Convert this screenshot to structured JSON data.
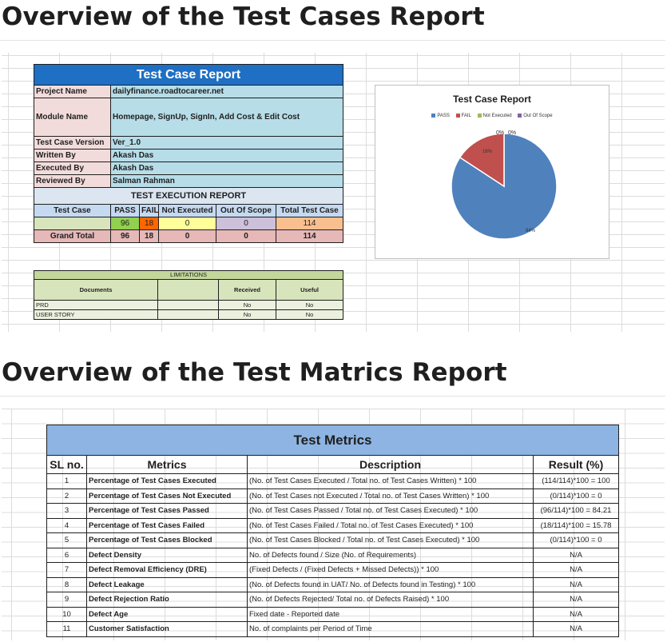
{
  "headings": {
    "section1": "Overview of the Test Cases Report",
    "section2": "Overview of the Test Matrics Report"
  },
  "test_case_report": {
    "title": "Test Case Report",
    "fields": [
      {
        "label": "Project Name",
        "value": "dailyfinance.roadtocareer.net"
      },
      {
        "label": "Module Name",
        "value": "Homepage, SignUp, SignIn, Add Cost & Edit Cost"
      },
      {
        "label": "Test Case Version",
        "value": "Ver_1.0"
      },
      {
        "label": "Written By",
        "value": "Akash Das"
      },
      {
        "label": "Executed By",
        "value": "Akash Das"
      },
      {
        "label": "Reviewed By",
        "value": "Salman Rahman"
      }
    ],
    "execution_report_title": "TEST EXECUTION REPORT",
    "columns": [
      "Test Case",
      "PASS",
      "FAIL",
      "Not Executed",
      "Out Of Scope",
      "Total Test Case"
    ],
    "row": {
      "pass": "96",
      "fail": "18",
      "not_executed": "0",
      "out_of_scope": "0",
      "total": "114"
    },
    "grand_total": {
      "label": "Grand Total",
      "pass": "96",
      "fail": "18",
      "not_executed": "0",
      "out_of_scope": "0",
      "total": "114"
    },
    "colors": {
      "pass": "#92d050",
      "fail": "#ff6600",
      "not_executed": "#ffff99",
      "out_of_scope": "#ccc0da",
      "total": "#fabf8f"
    }
  },
  "limitations": {
    "title": "LIMITATIONS",
    "columns": [
      "Documents",
      "",
      "Received",
      "Useful"
    ],
    "rows": [
      {
        "document": "PRD",
        "received": "No",
        "useful": "No"
      },
      {
        "document": "USER STORY",
        "received": "No",
        "useful": "No"
      }
    ]
  },
  "chart_data": {
    "type": "pie",
    "title": "Test Case Report",
    "categories": [
      "PASS",
      "FAIL",
      "Not Executed",
      "Out Of Scope"
    ],
    "values": [
      96,
      18,
      0,
      0
    ],
    "labels": [
      "84%",
      "16%",
      "0%",
      "0%"
    ],
    "colors": [
      "#4f81bd",
      "#c0504d",
      "#9bbb59",
      "#8064a2"
    ],
    "legend_position": "top"
  },
  "metrics": {
    "title": "Test Metrics",
    "columns": [
      "SL no.",
      "Metrics",
      "Description",
      "Result (%)"
    ],
    "rows": [
      {
        "sl": "1",
        "metric": "Percentage of Test Cases Executed",
        "description": "(No. of Test Cases Executed / Total no. of Test Cases Written) * 100",
        "result": "(114/114)*100 = 100"
      },
      {
        "sl": "2",
        "metric": "Percentage of Test Cases Not Executed",
        "description": "(No. of Test Cases not Executed / Total no. of Test Cases Written) * 100",
        "result": "(0/114)*100 = 0"
      },
      {
        "sl": "3",
        "metric": "Percentage of Test Cases Passed",
        "description": "(No. of Test Cases Passed / Total no. of Test Cases Executed) * 100",
        "result": "(96/114)*100 = 84.21"
      },
      {
        "sl": "4",
        "metric": "Percentage of Test Cases Failed",
        "description": "(No. of Test Cases Failed / Total no. of Test Cases Executed) * 100",
        "result": "(18/114)*100 = 15.78"
      },
      {
        "sl": "5",
        "metric": "Percentage of Test Cases Blocked",
        "description": "(No. of Test Cases Blocked / Total no. of Test Cases Executed) * 100",
        "result": "(0/114)*100 = 0"
      },
      {
        "sl": "6",
        "metric": "Defect Density",
        "description": "No. of Defects found / Size (No. of Requirements)",
        "result": "N/A"
      },
      {
        "sl": "7",
        "metric": "Defect Removal Efficiency (DRE)",
        "description": "(Fixed Defects / (Fixed Defects + Missed Defects)) * 100",
        "result": "N/A"
      },
      {
        "sl": "8",
        "metric": "Defect Leakage",
        "description": "(No. of Defects found in UAT/ No. of Defects found in Testing) * 100",
        "result": "N/A"
      },
      {
        "sl": "9",
        "metric": "Defect Rejection Ratio",
        "description": "(No. of Defects Rejected/ Total no. of Defects Raised) * 100",
        "result": "N/A"
      },
      {
        "sl": "10",
        "metric": "Defect Age",
        "description": "Fixed date - Reported date",
        "result": "N/A"
      },
      {
        "sl": "11",
        "metric": "Customer Satisfaction",
        "description": "No. of complaints per Period of Time",
        "result": "N/A"
      }
    ],
    "colors": {
      "title_bg": "#8db4e2"
    }
  }
}
